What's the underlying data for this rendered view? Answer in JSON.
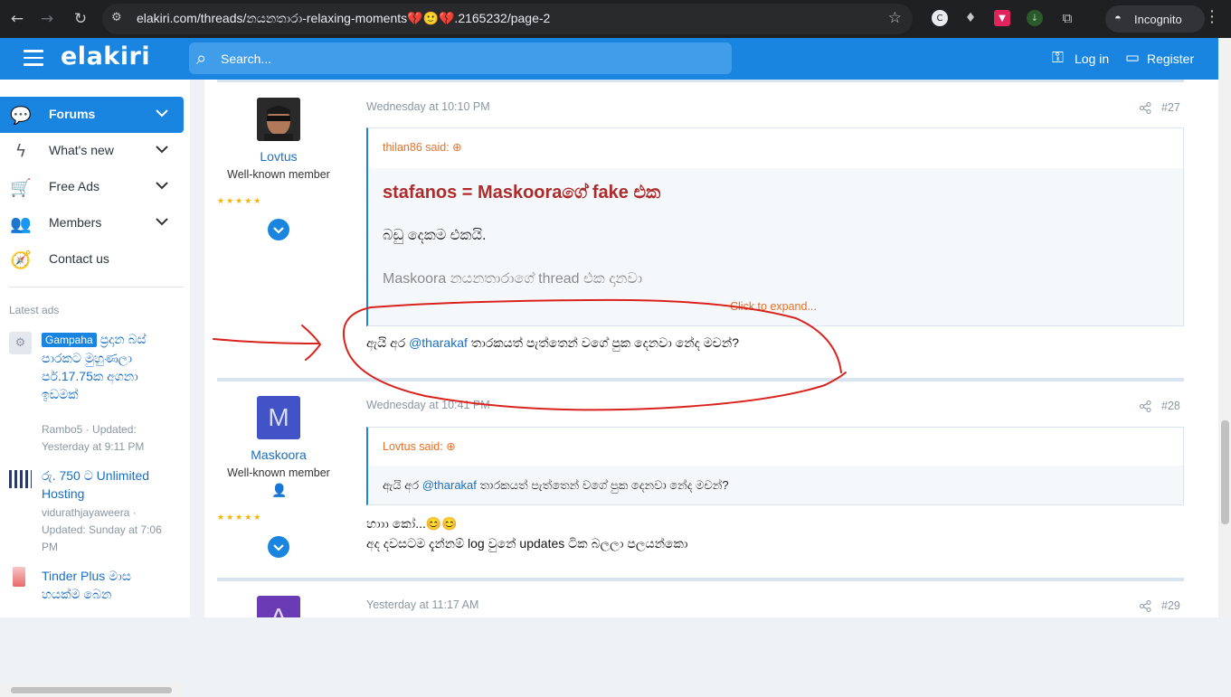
{
  "browser": {
    "url": "elakiri.com/threads/නයනතාරා-relaxing-moments💔🙂💔.2165232/page-2",
    "incognito_label": "Incognito"
  },
  "header": {
    "logo": "elakiri",
    "search_placeholder": "Search...",
    "login": "Log in",
    "register": "Register"
  },
  "sidebar": {
    "items": [
      {
        "label": "Forums"
      },
      {
        "label": "What's new"
      },
      {
        "label": "Free Ads"
      },
      {
        "label": "Members"
      },
      {
        "label": "Contact us"
      }
    ],
    "latest_ads_heading": "Latest ads",
    "ads": [
      {
        "tag": "Gampaha",
        "title": "ප්‍රදාන බස් පාරකට මුහුණලා පර්.17.75ක අගනා ඉඩමක්",
        "meta": "Rambo5 · Updated: Yesterday at 9:11 PM"
      },
      {
        "title": "රු. 750 ට Unlimited Hosting",
        "meta": "vidurathjayaweera · Updated: Sunday at 7:06 PM"
      },
      {
        "title": "Tinder Plus මාස හයක්ම බෙන"
      }
    ]
  },
  "posts": [
    {
      "author": "Lovtus",
      "user_title": "Well-known member",
      "date": "Wednesday at 10:10 PM",
      "number": "#27",
      "quote_by": "thilan86 said:",
      "quote_heading": "stafanos = Maskooraගේ fake එක",
      "quote_line1": "බඩු දෙකම එකයි.",
      "quote_line2": "Maskoora නයනතාරාගේ thread එක දානවා",
      "click_expand": "Click to expand...",
      "message_pre": "ඇයි අර ",
      "message_mention": "@tharakaf",
      "message_post": " තාරකයත් පැත්තෙන් වගේ පුක දෙනවා නේද මචන්?"
    },
    {
      "author": "Maskoora",
      "avatar_letter": "M",
      "user_title": "Well-known member",
      "date": "Wednesday at 10:41 PM",
      "number": "#28",
      "quote_by": "Lovtus said:",
      "quote_pre": "ඇයි අර ",
      "quote_mention": "@tharakaf",
      "quote_post": " තාරකයත් පැත්තෙන් වගේ පුක දෙනවා නේද මචන්?",
      "message_line1": "හාාා කෝ...😊😊",
      "message_line2": "අද දවසටම දැන්නම් log වුනේ updates ටික බලලා පලයන්කො"
    },
    {
      "avatar_letter": "A",
      "date": "Yesterday at 11:17 AM",
      "number": "#29"
    }
  ],
  "colors": {
    "brand": "#1a85e0",
    "quote_author": "#e5702a",
    "annotation": "#d9221c"
  }
}
